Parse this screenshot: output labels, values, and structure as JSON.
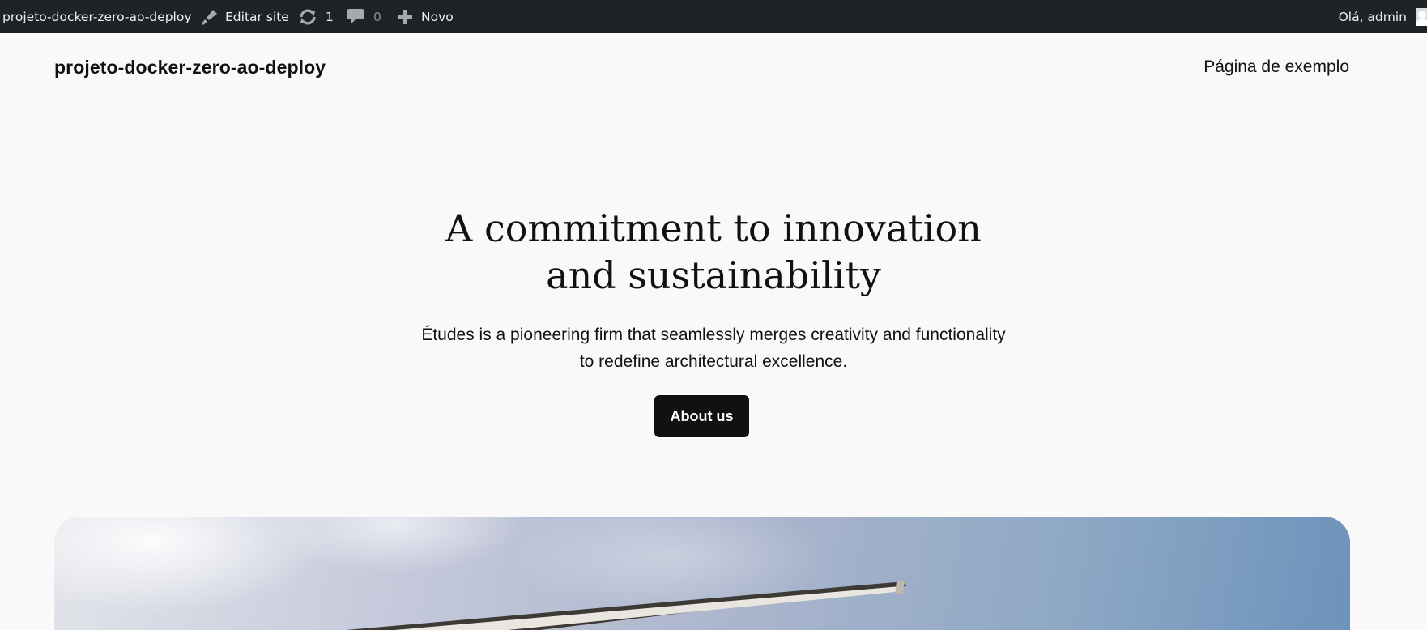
{
  "admin_bar": {
    "site_name": "projeto-docker-zero-ao-deploy",
    "edit_site_label": "Editar site",
    "updates_count": "1",
    "comments_count": "0",
    "new_label": "Novo",
    "greeting": "Olá, admin",
    "icons": [
      "paint-brush-icon",
      "updates-icon",
      "comment-icon",
      "plus-icon",
      "avatar"
    ]
  },
  "header": {
    "site_title": "projeto-docker-zero-ao-deploy",
    "nav": [
      {
        "label": "Página de exemplo"
      }
    ]
  },
  "hero": {
    "heading_line1": "A commitment to innovation",
    "heading_line2": "and sustainability",
    "text": "Études is a pioneering firm that seamlessly merges creativity and functionality to redefine architectural excellence.",
    "button_label": "About us"
  },
  "colors": {
    "admin_bar_bg": "#1d2327",
    "page_bg": "#f9f9f9",
    "text": "#111111",
    "button_bg": "#111111",
    "button_text": "#ffffff"
  }
}
